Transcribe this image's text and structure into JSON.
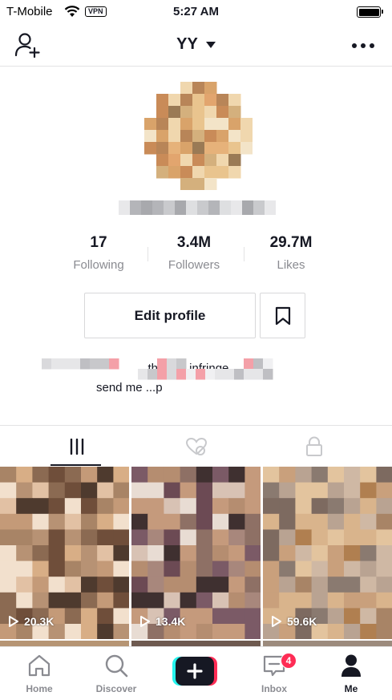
{
  "status_bar": {
    "carrier": "T-Mobile",
    "vpn": "VPN",
    "time": "5:27 AM"
  },
  "header": {
    "title": "YY"
  },
  "stats": [
    {
      "value": "17",
      "label": "Following"
    },
    {
      "value": "3.4M",
      "label": "Followers"
    },
    {
      "value": "29.7M",
      "label": "Likes"
    }
  ],
  "actions": {
    "edit_profile": "Edit profile"
  },
  "bio": {
    "line1": "...this ...y infringe... ...ase",
    "line2": "send me ...p"
  },
  "tabs": [
    {
      "name": "videos",
      "icon": "grid-icon",
      "active": true
    },
    {
      "name": "liked",
      "icon": "heart-hidden-icon",
      "active": false
    },
    {
      "name": "private",
      "icon": "lock-icon",
      "active": false
    }
  ],
  "videos": [
    {
      "views": "20.3K"
    },
    {
      "views": "13.4K"
    },
    {
      "views": "59.6K"
    }
  ],
  "bottom_nav": {
    "items": [
      {
        "label": "Home",
        "icon": "home-icon",
        "active": false
      },
      {
        "label": "Discover",
        "icon": "search-icon",
        "active": false
      },
      {
        "label": "",
        "icon": "create-icon",
        "active": false
      },
      {
        "label": "Inbox",
        "icon": "inbox-icon",
        "active": false,
        "badge": "4"
      },
      {
        "label": "Me",
        "icon": "profile-icon",
        "active": true
      }
    ]
  },
  "colors": {
    "accent": "#fe2c55",
    "cyan": "#25f4ee",
    "text_primary": "#161823",
    "text_secondary": "#8a8b91",
    "divider": "#e3e3e4"
  }
}
